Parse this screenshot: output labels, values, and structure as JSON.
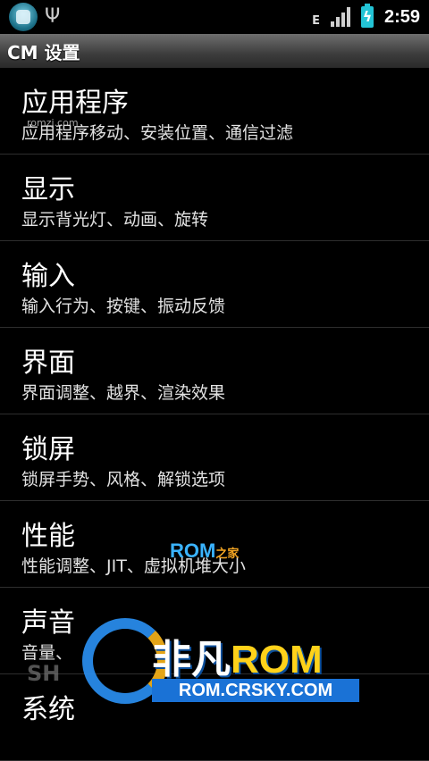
{
  "status_bar": {
    "icons": [
      "app-notification-icon",
      "usb-icon",
      "edge-data-icon",
      "signal-icon",
      "battery-charging-icon"
    ],
    "edge_label": "E",
    "time": "2:59",
    "battery_color": "#23c4d6"
  },
  "title_bar": {
    "title": "CM 设置"
  },
  "settings": {
    "items": [
      {
        "title": "应用程序",
        "summary": "应用程序移动、安装位置、通信过滤"
      },
      {
        "title": "显示",
        "summary": "显示背光灯、动画、旋转"
      },
      {
        "title": "输入",
        "summary": "输入行为、按键、振动反馈"
      },
      {
        "title": "界面",
        "summary": "界面调整、越界、渲染效果"
      },
      {
        "title": "锁屏",
        "summary": "锁屏手势、风格、解锁选项"
      },
      {
        "title": "性能",
        "summary": "性能调整、JIT、虚拟机堆大小"
      },
      {
        "title": "声音",
        "summary": "音量、"
      },
      {
        "title": "系统",
        "summary": ""
      }
    ]
  },
  "watermarks": {
    "small": "romzj.com",
    "rom": "ROM",
    "rom_suffix": "之家",
    "logo_part1": "非凡",
    "logo_part2": "ROM",
    "domain": "ROM.CRSKY.COM",
    "sh": "SH"
  }
}
